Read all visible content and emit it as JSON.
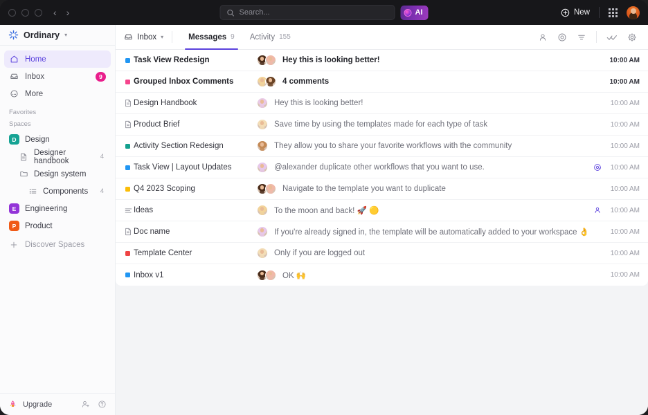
{
  "titlebar": {
    "nav_back": "‹",
    "nav_forward": "›",
    "search_placeholder": "Search...",
    "ai_label": "AI",
    "new_label": "New"
  },
  "sidebar": {
    "workspace_name": "Ordinary",
    "nav": [
      {
        "label": "Home",
        "icon": "home-icon",
        "badge": "",
        "active": true
      },
      {
        "label": "Inbox",
        "icon": "inbox-icon",
        "badge": "9",
        "active": false
      },
      {
        "label": "More",
        "icon": "more-icon",
        "badge": "",
        "active": false
      }
    ],
    "favorites_label": "Favorites",
    "spaces_label": "Spaces",
    "spaces": [
      {
        "label": "Design",
        "chip": "D",
        "color": "#15a394",
        "count": "",
        "indent": 0,
        "icon": "space-chip"
      },
      {
        "label": "Designer handbook",
        "chip": "",
        "color": "",
        "count": "4",
        "indent": 1,
        "icon": "doc-icon"
      },
      {
        "label": "Design system",
        "chip": "",
        "color": "",
        "count": "",
        "indent": 1,
        "icon": "folder-icon"
      },
      {
        "label": "Components",
        "chip": "",
        "color": "",
        "count": "4",
        "indent": 2,
        "icon": "list-icon"
      },
      {
        "label": "Engineering",
        "chip": "E",
        "color": "#9334d8",
        "count": "",
        "indent": 0,
        "icon": "space-chip"
      },
      {
        "label": "Product",
        "chip": "P",
        "color": "#f05a17",
        "count": "",
        "indent": 0,
        "icon": "space-chip"
      }
    ],
    "discover_label": "Discover Spaces",
    "upgrade_label": "Upgrade"
  },
  "panel": {
    "inbox_selector": "Inbox",
    "tabs": [
      {
        "label": "Messages",
        "count": "9",
        "active": true
      },
      {
        "label": "Activity",
        "count": "155",
        "active": false
      }
    ]
  },
  "messages": [
    {
      "title": "Task View Redesign",
      "icon": "status-square",
      "color": "#2196f3",
      "preview": "Hey this is looking better!",
      "time": "10:00 AM",
      "unread": true,
      "avatars": [
        "#4a2c1a",
        "#f0b9a8"
      ],
      "flag": ""
    },
    {
      "title": "Grouped Inbox Comments",
      "icon": "status-square",
      "color": "#f5448c",
      "preview": "4 comments",
      "time": "10:00 AM",
      "unread": true,
      "avatars": [
        "#f2d39a",
        "#6b4426"
      ],
      "flag": ""
    },
    {
      "title": "Design Handbook",
      "icon": "doc-icon",
      "color": "",
      "preview": "Hey this is looking better!",
      "time": "10:00 AM",
      "unread": false,
      "avatars": [
        "#e9c9e6"
      ],
      "flag": ""
    },
    {
      "title": "Product Brief",
      "icon": "doc-icon",
      "color": "",
      "preview": "Save time by using the templates made for each type of task",
      "time": "10:00 AM",
      "unread": false,
      "avatars": [
        "#f3ddb6"
      ],
      "flag": ""
    },
    {
      "title": "Activity Section Redesign",
      "icon": "status-square",
      "color": "#14a08e",
      "preview": "They allow you to share your favorite workflows with the community",
      "time": "10:00 AM",
      "unread": false,
      "avatars": [
        "#c48a56"
      ],
      "flag": ""
    },
    {
      "title": "Task View | Layout Updates",
      "icon": "status-square",
      "color": "#2196f3",
      "preview": "@alexander duplicate other workflows that you want to use.",
      "time": "10:00 AM",
      "unread": false,
      "avatars": [
        "#e7c8ea"
      ],
      "flag": "mention-icon"
    },
    {
      "title": "Q4 2023 Scoping",
      "icon": "status-square",
      "color": "#fbbd08",
      "preview": "Navigate to the template you want to duplicate",
      "time": "10:00 AM",
      "unread": false,
      "avatars": [
        "#4a2c1a",
        "#f0b9a8"
      ],
      "flag": ""
    },
    {
      "title": "Ideas",
      "icon": "list-icon",
      "color": "",
      "preview": "To the moon and back! 🚀 🟡",
      "time": "10:00 AM",
      "unread": false,
      "avatars": [
        "#f2d39a"
      ],
      "flag": "assignee-icon"
    },
    {
      "title": "Doc name",
      "icon": "doc-icon",
      "color": "",
      "preview": "If you're already signed in, the template will be automatically added to your workspace 👌",
      "time": "10:00 AM",
      "unread": false,
      "avatars": [
        "#e7c8ea"
      ],
      "flag": ""
    },
    {
      "title": "Template Center",
      "icon": "status-square",
      "color": "#ef4444",
      "preview": "Only if you are logged out",
      "time": "10:00 AM",
      "unread": false,
      "avatars": [
        "#f3ddb6"
      ],
      "flag": ""
    },
    {
      "title": "Inbox v1",
      "icon": "status-square",
      "color": "#2196f3",
      "preview": "OK 🙌",
      "time": "10:00 AM",
      "unread": false,
      "avatars": [
        "#4a2c1a",
        "#f0b9a8"
      ],
      "flag": ""
    }
  ],
  "colors": {
    "accent": "#5a41dd",
    "badge": "#e91e8c",
    "titlebar": "#17171a"
  }
}
